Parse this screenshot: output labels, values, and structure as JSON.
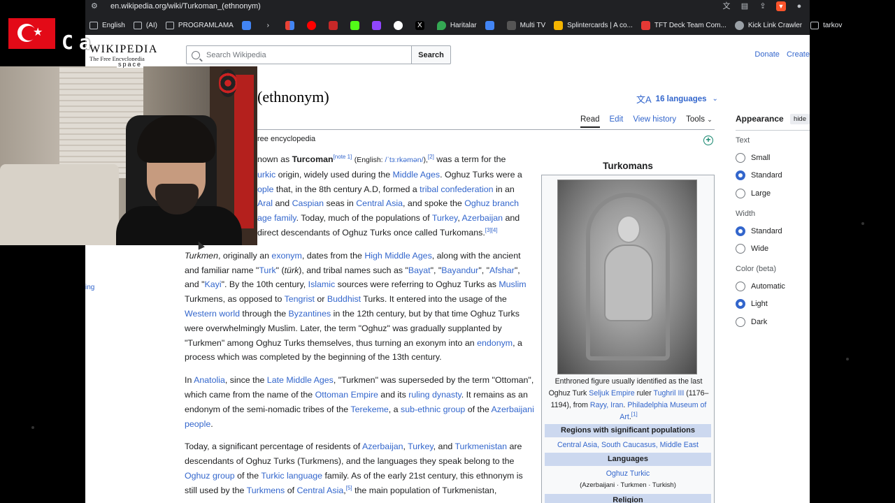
{
  "browser": {
    "url": "en.wikipedia.org/wiki/Turkoman_(ethnonym)",
    "bookmarks": [
      {
        "label": "English",
        "icon": "folder-icon",
        "color": ""
      },
      {
        "label": "(AI)",
        "icon": "folder-icon",
        "color": ""
      },
      {
        "label": "PROGRAMLAMA",
        "icon": "folder-icon",
        "color": ""
      },
      {
        "label": "",
        "icon": "translate-icon",
        "color": "#4285f4"
      },
      {
        "label": "",
        "icon": "arrow-icon",
        "color": "#5f6368"
      },
      {
        "label": "",
        "icon": "app-grid-icon",
        "color": "#e94235"
      },
      {
        "label": "",
        "icon": "youtube-icon",
        "color": "#ff0000"
      },
      {
        "label": "",
        "icon": "app-icon",
        "color": "#c62828"
      },
      {
        "label": "",
        "icon": "kick-icon",
        "color": "#53fc18"
      },
      {
        "label": "",
        "icon": "twitch-icon",
        "color": "#9146ff"
      },
      {
        "label": "",
        "icon": "google-icon",
        "color": "#ffffff"
      },
      {
        "label": "",
        "icon": "x-icon",
        "color": "#000000"
      },
      {
        "label": "Haritalar",
        "icon": "maps-icon",
        "color": "#34a853"
      },
      {
        "label": "",
        "icon": "gs-icon",
        "color": "#4285f4"
      },
      {
        "label": "Multi TV",
        "icon": "app-icon",
        "color": "#555555"
      },
      {
        "label": "Splintercards | A co...",
        "icon": "app-icon",
        "color": "#f4b400"
      },
      {
        "label": "TFT Deck Team Com...",
        "icon": "app-icon",
        "color": "#e53935"
      },
      {
        "label": "Kick Link Crawler",
        "icon": "globe-icon",
        "color": "#9aa0a6"
      },
      {
        "label": "tarkov",
        "icon": "folder-icon",
        "color": ""
      }
    ]
  },
  "wiki": {
    "logo_word": "WIKIPEDIA",
    "logo_tagline": "The Free Encyclopedia",
    "search_placeholder": "Search Wikipedia",
    "search_button": "Search",
    "donate": "Donate",
    "create": "Create",
    "title": "(ethnonym)",
    "languages": "16 languages",
    "tabs": [
      "Read",
      "Edit",
      "View history",
      "Tools"
    ],
    "from": "ree encyclopedia",
    "side_link": "ing",
    "infobox": {
      "title": "Turkomans",
      "regions_header": "Regions with significant populations",
      "languages_header": "Languages",
      "language_main": "Oghuz Turkic",
      "language_sub": "(Azerbaijani · Turkmen · Turkish)",
      "religion_header": "Religion"
    }
  },
  "appearance": {
    "title": "Appearance",
    "hide": "hide",
    "text_label": "Text",
    "text_options": [
      "Small",
      "Standard",
      "Large"
    ],
    "width_label": "Width",
    "width_options": [
      "Standard",
      "Wide"
    ],
    "color_label": "Color (beta)",
    "color_options": [
      "Automatic",
      "Light",
      "Dark"
    ]
  },
  "overlay": {
    "stream_letters": "Ca",
    "space_label": "space"
  }
}
